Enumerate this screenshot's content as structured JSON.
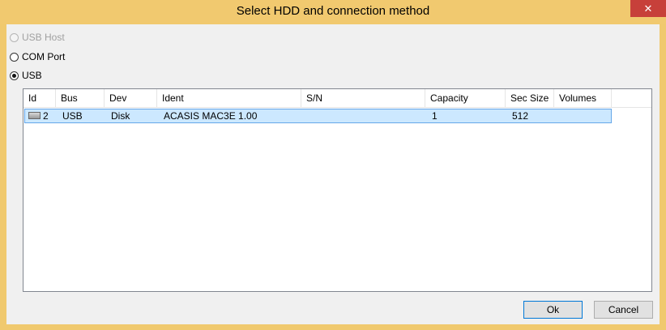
{
  "window": {
    "title": "Select HDD and connection method",
    "close_glyph": "✕"
  },
  "connection": {
    "options": [
      {
        "label": "USB Host",
        "state": "disabled"
      },
      {
        "label": "COM Port",
        "state": "unselected"
      },
      {
        "label": "USB",
        "state": "selected"
      }
    ]
  },
  "table": {
    "columns": [
      "Id",
      "Bus",
      "Dev",
      "Ident",
      "S/N",
      "Capacity",
      "Sec Size",
      "Volumes"
    ],
    "rows": [
      {
        "icon": "drive-icon",
        "id": "2",
        "bus": "USB",
        "dev": "Disk",
        "ident": "ACASIS MAC3E 1.00",
        "sn": "",
        "capacity": "1",
        "sec_size": "512",
        "volumes": ""
      }
    ]
  },
  "buttons": {
    "ok_label": "Ok",
    "cancel_label": "Cancel"
  },
  "colors": {
    "title_bar": "#f1c96f",
    "close_button": "#c7403a",
    "row_selected": "#cce8ff",
    "default_button_border": "#0078d7"
  }
}
